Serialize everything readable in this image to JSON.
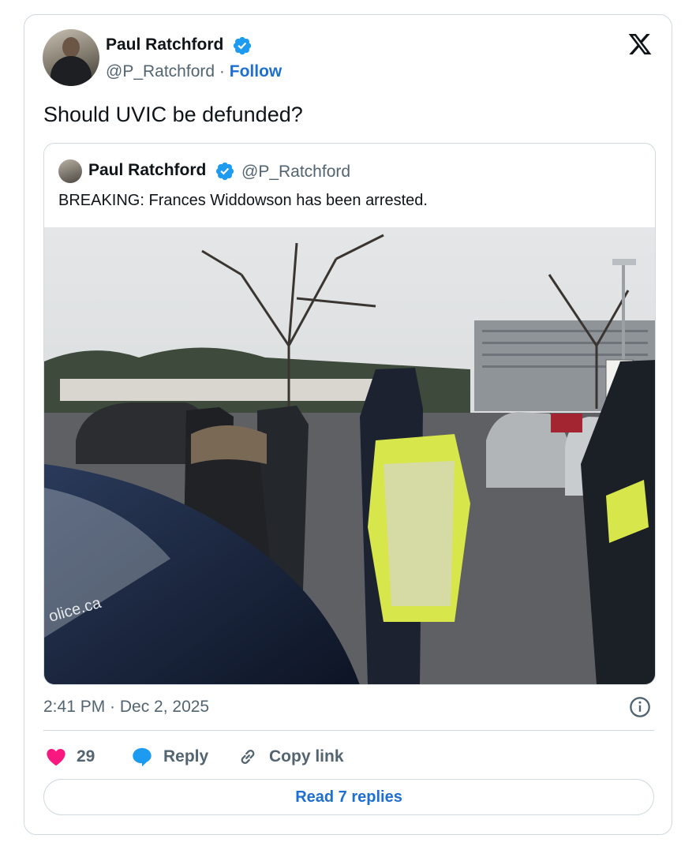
{
  "tweet": {
    "author_name": "Paul Ratchford",
    "author_handle": "@P_Ratchford",
    "separator": "·",
    "follow_label": "Follow",
    "text": "Should UVIC be defunded?",
    "timestamp": "2:41 PM · Dec 2, 2025"
  },
  "quoted_tweet": {
    "author_name": "Paul Ratchford",
    "author_handle": "@P_Ratchford",
    "text": "BREAKING: Frances Widdowson has been arrested.",
    "photo_watermark": "olice.ca"
  },
  "actions": {
    "like_count": "29",
    "reply_label": "Reply",
    "copy_link_label": "Copy link"
  },
  "read_replies_label": "Read 7 replies",
  "icons": {
    "verified": "verified-badge-icon",
    "x_logo": "x-logo-icon",
    "info": "info-icon",
    "like": "heart-icon",
    "reply": "speech-bubble-icon",
    "link": "link-icon"
  },
  "colors": {
    "accent": "#1d6fd0",
    "verified": "#1d9bf0",
    "like": "#f91880",
    "muted_text": "#536471",
    "border": "#cfd9de"
  }
}
